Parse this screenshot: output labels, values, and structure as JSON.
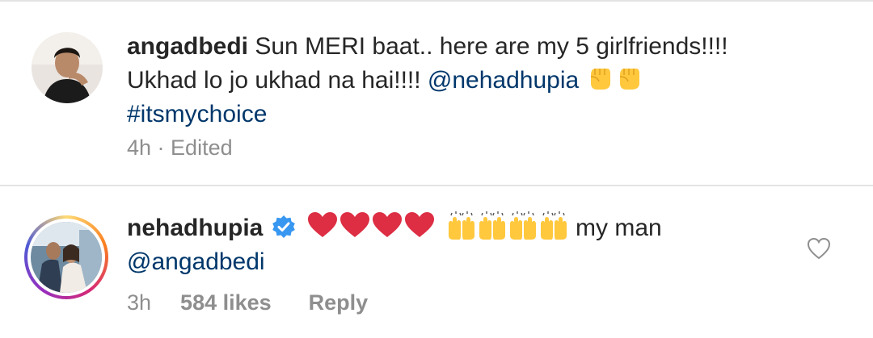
{
  "comments": [
    {
      "username": "angadbedi",
      "text_line1": " Sun MERI baat.. here are my 5 girlfriends!!!!",
      "text_line2_prefix": "Ukhad lo jo ukhad na hai!!!! ",
      "mention": "@nehadhupia",
      "emoji": "raised-fist-icon x2",
      "hashtag": "#itsmychoice",
      "time": "4h",
      "separator": " · ",
      "edited": "Edited"
    },
    {
      "username": "nehadhupia",
      "verified": true,
      "emoji_hearts": "red-heart-icon x4",
      "emoji_hands": "raising-hands-icon x4",
      "text": " my man",
      "mention": "@angadbedi",
      "time": "3h",
      "likes": "584 likes",
      "reply": "Reply"
    }
  ],
  "colors": {
    "text": "#262626",
    "link": "#00376b",
    "muted": "#8e8e8e",
    "verified": "#3897f0",
    "divider": "#e3e3e3"
  }
}
